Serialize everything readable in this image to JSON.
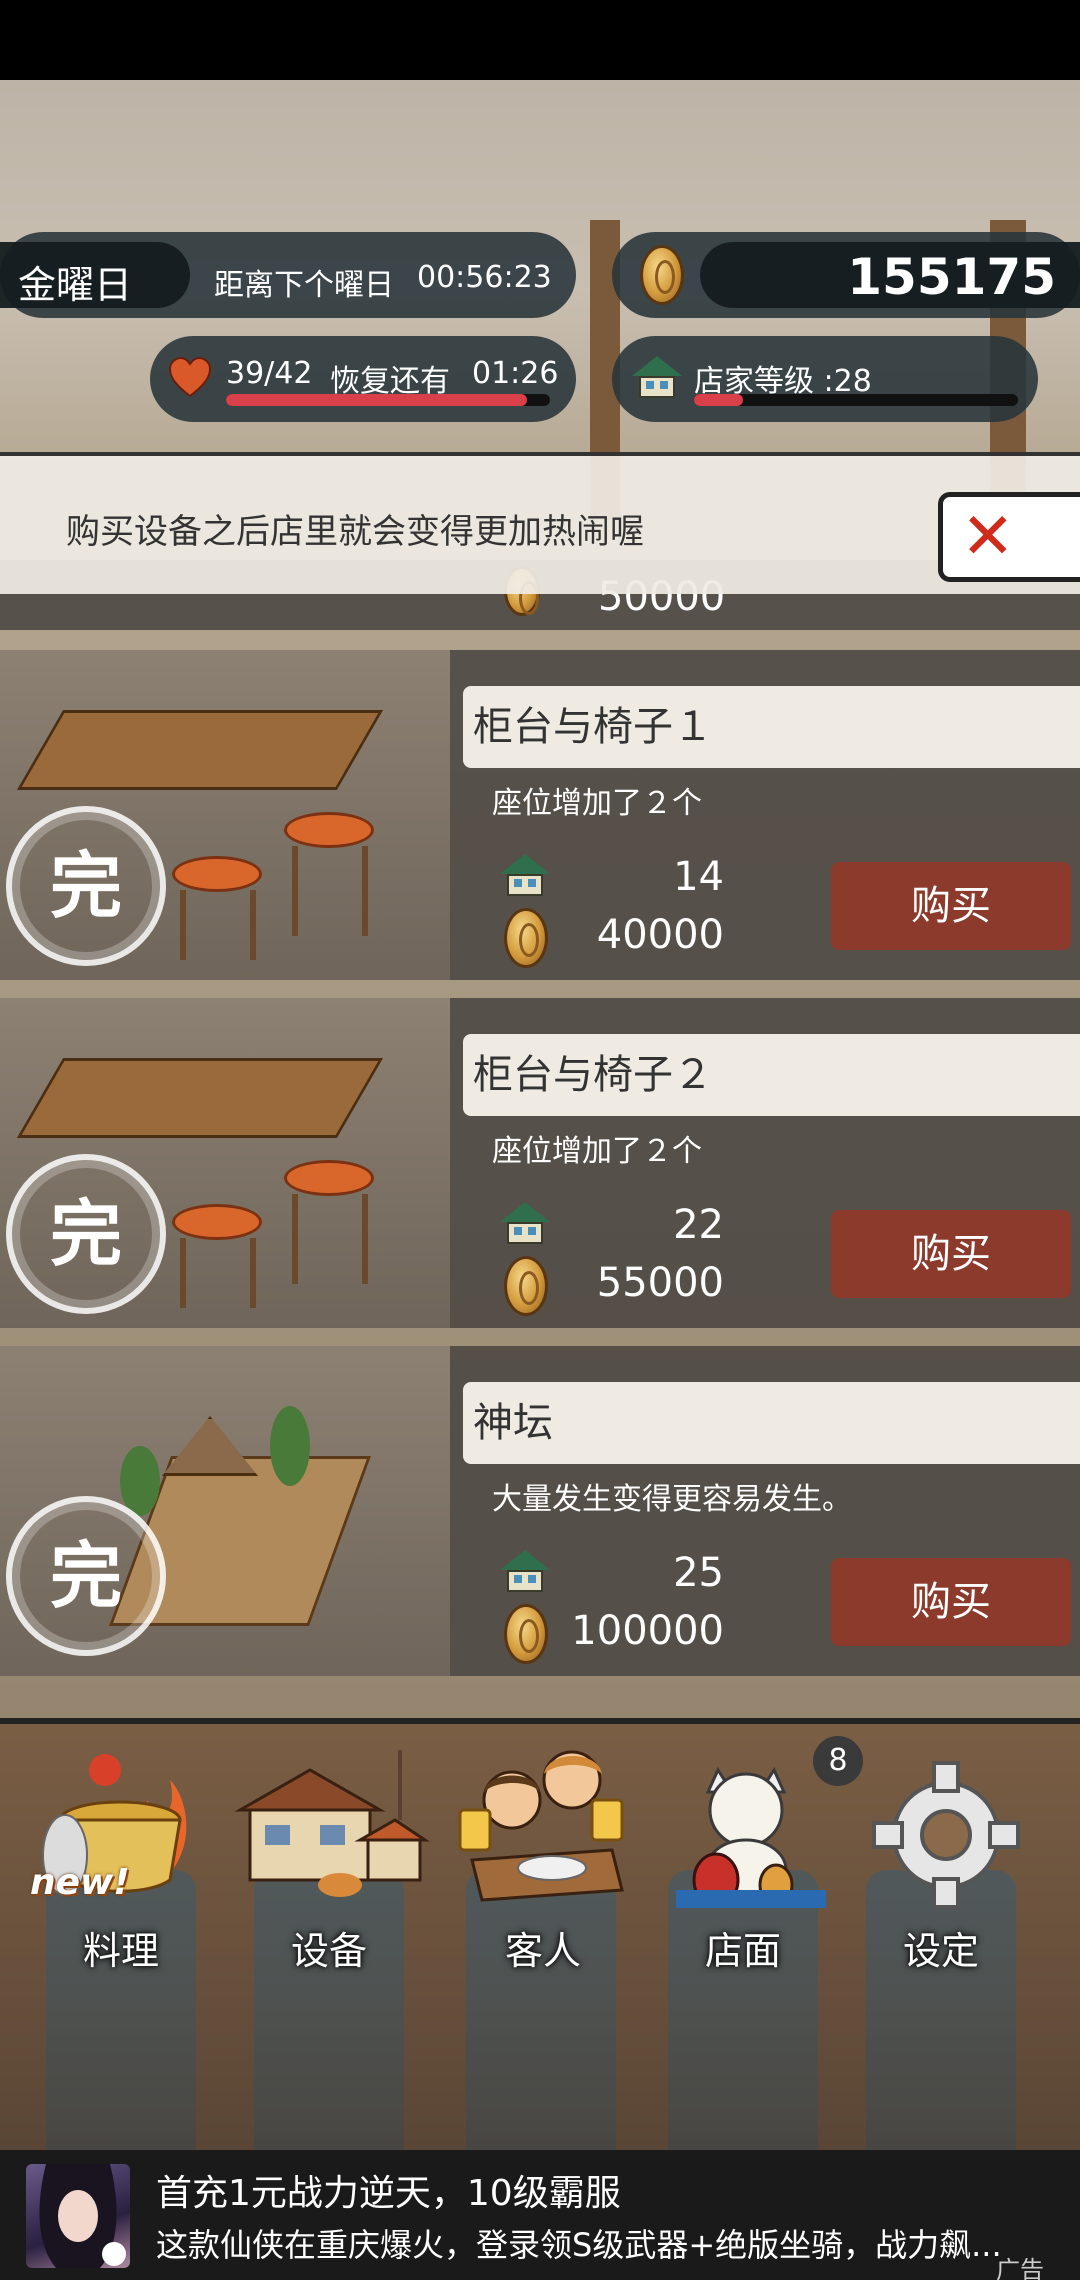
{
  "hud": {
    "day_name": "金曜日",
    "next_day_label": "距离下个曜日",
    "next_day_timer": "00:56:23",
    "coins": "155175",
    "stamina": "39/42",
    "recover_label": "恢复还有",
    "recover_timer": "01:26",
    "stamina_fraction": 0.93,
    "shop_level_label": "店家等级 :28",
    "shop_level_fraction": 0.15
  },
  "notice": {
    "text": "购买设备之后店里就会变得更加热闹喔",
    "close_icon": "close-x-icon"
  },
  "partial_item": {
    "price": "50000"
  },
  "items": [
    {
      "name": "柜台与椅子１",
      "desc": "座位增加了２个",
      "level": "14",
      "price": "40000",
      "buy_label": "购买",
      "stamp": "完"
    },
    {
      "name": "柜台与椅子２",
      "desc": "座位增加了２个",
      "level": "22",
      "price": "55000",
      "buy_label": "购买",
      "stamp": "完"
    },
    {
      "name": "神坛",
      "desc": "大量发生变得更容易发生。",
      "level": "25",
      "price": "100000",
      "buy_label": "购买",
      "stamp": "完"
    }
  ],
  "nav": {
    "new_tag": "new!",
    "cooking": "料理",
    "equipment": "设备",
    "customers": "客人",
    "shop": "店面",
    "settings": "设定",
    "shop_badge": "8"
  },
  "ad": {
    "title": "首充1元战力逆天，10级霸服",
    "desc": "这款仙侠在重庆爆火，登录领S级武器+绝版坐骑，战力飙...",
    "label": "广告"
  },
  "colors": {
    "buy_button": "#8b3a2c",
    "hud_bar_fill": "#d9404a",
    "close_x": "#d02a1a"
  }
}
